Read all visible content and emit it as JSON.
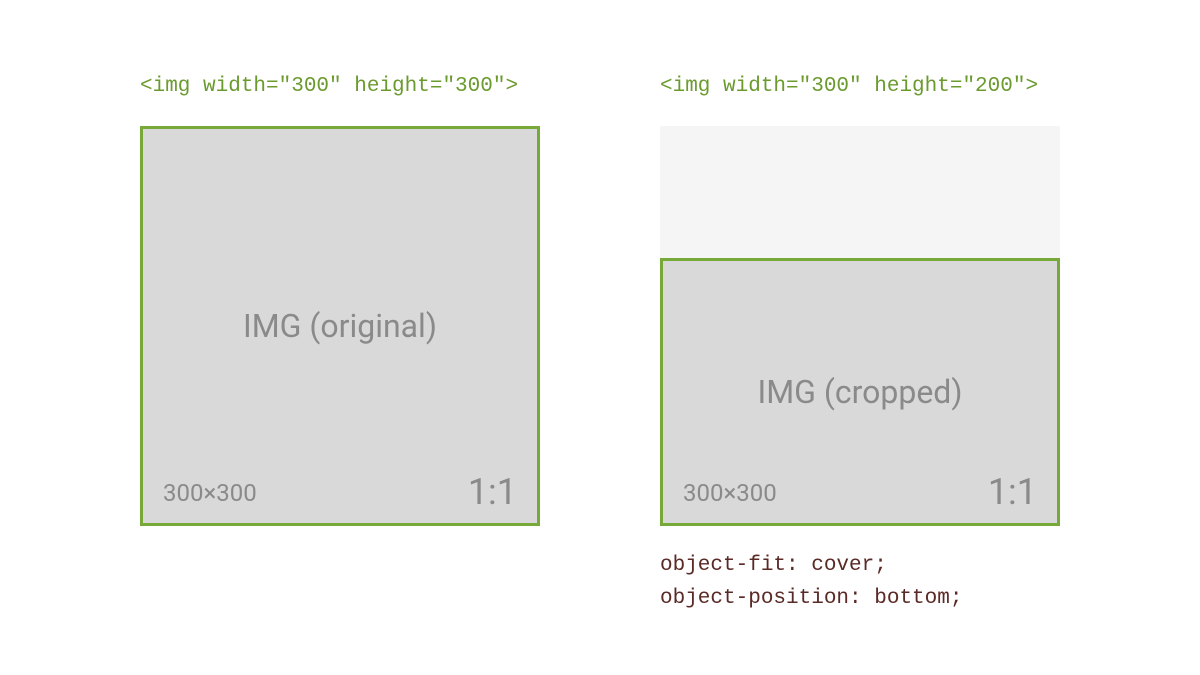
{
  "left": {
    "code_label": "<img width=\"300\" height=\"300\">",
    "center_text": "IMG (original)",
    "dimensions": "300×300",
    "ratio": "1:1"
  },
  "right": {
    "code_label": "<img width=\"300\" height=\"200\">",
    "center_text": "IMG (cropped)",
    "dimensions": "300×300",
    "ratio": "1:1",
    "css_line1": "object-fit: cover;",
    "css_line2": "object-position: bottom;"
  }
}
